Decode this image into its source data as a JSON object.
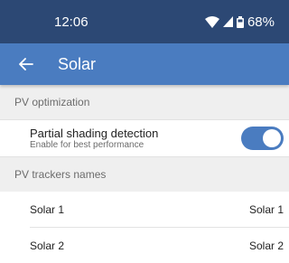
{
  "status_bar": {
    "time": "12:06",
    "battery": "68%"
  },
  "app_bar": {
    "title": "Solar"
  },
  "sections": {
    "pv_optimization": "PV optimization",
    "pv_trackers": "PV trackers names"
  },
  "partial_shading": {
    "title": "Partial shading detection",
    "subtitle": "Enable for best performance",
    "enabled": true
  },
  "trackers": [
    {
      "label": "Solar 1",
      "value": "Solar 1"
    },
    {
      "label": "Solar 2",
      "value": "Solar 2"
    }
  ],
  "colors": {
    "status_bar": "#2c4874",
    "app_bar": "#4a7cc0",
    "accent": "#4a7cc0"
  }
}
